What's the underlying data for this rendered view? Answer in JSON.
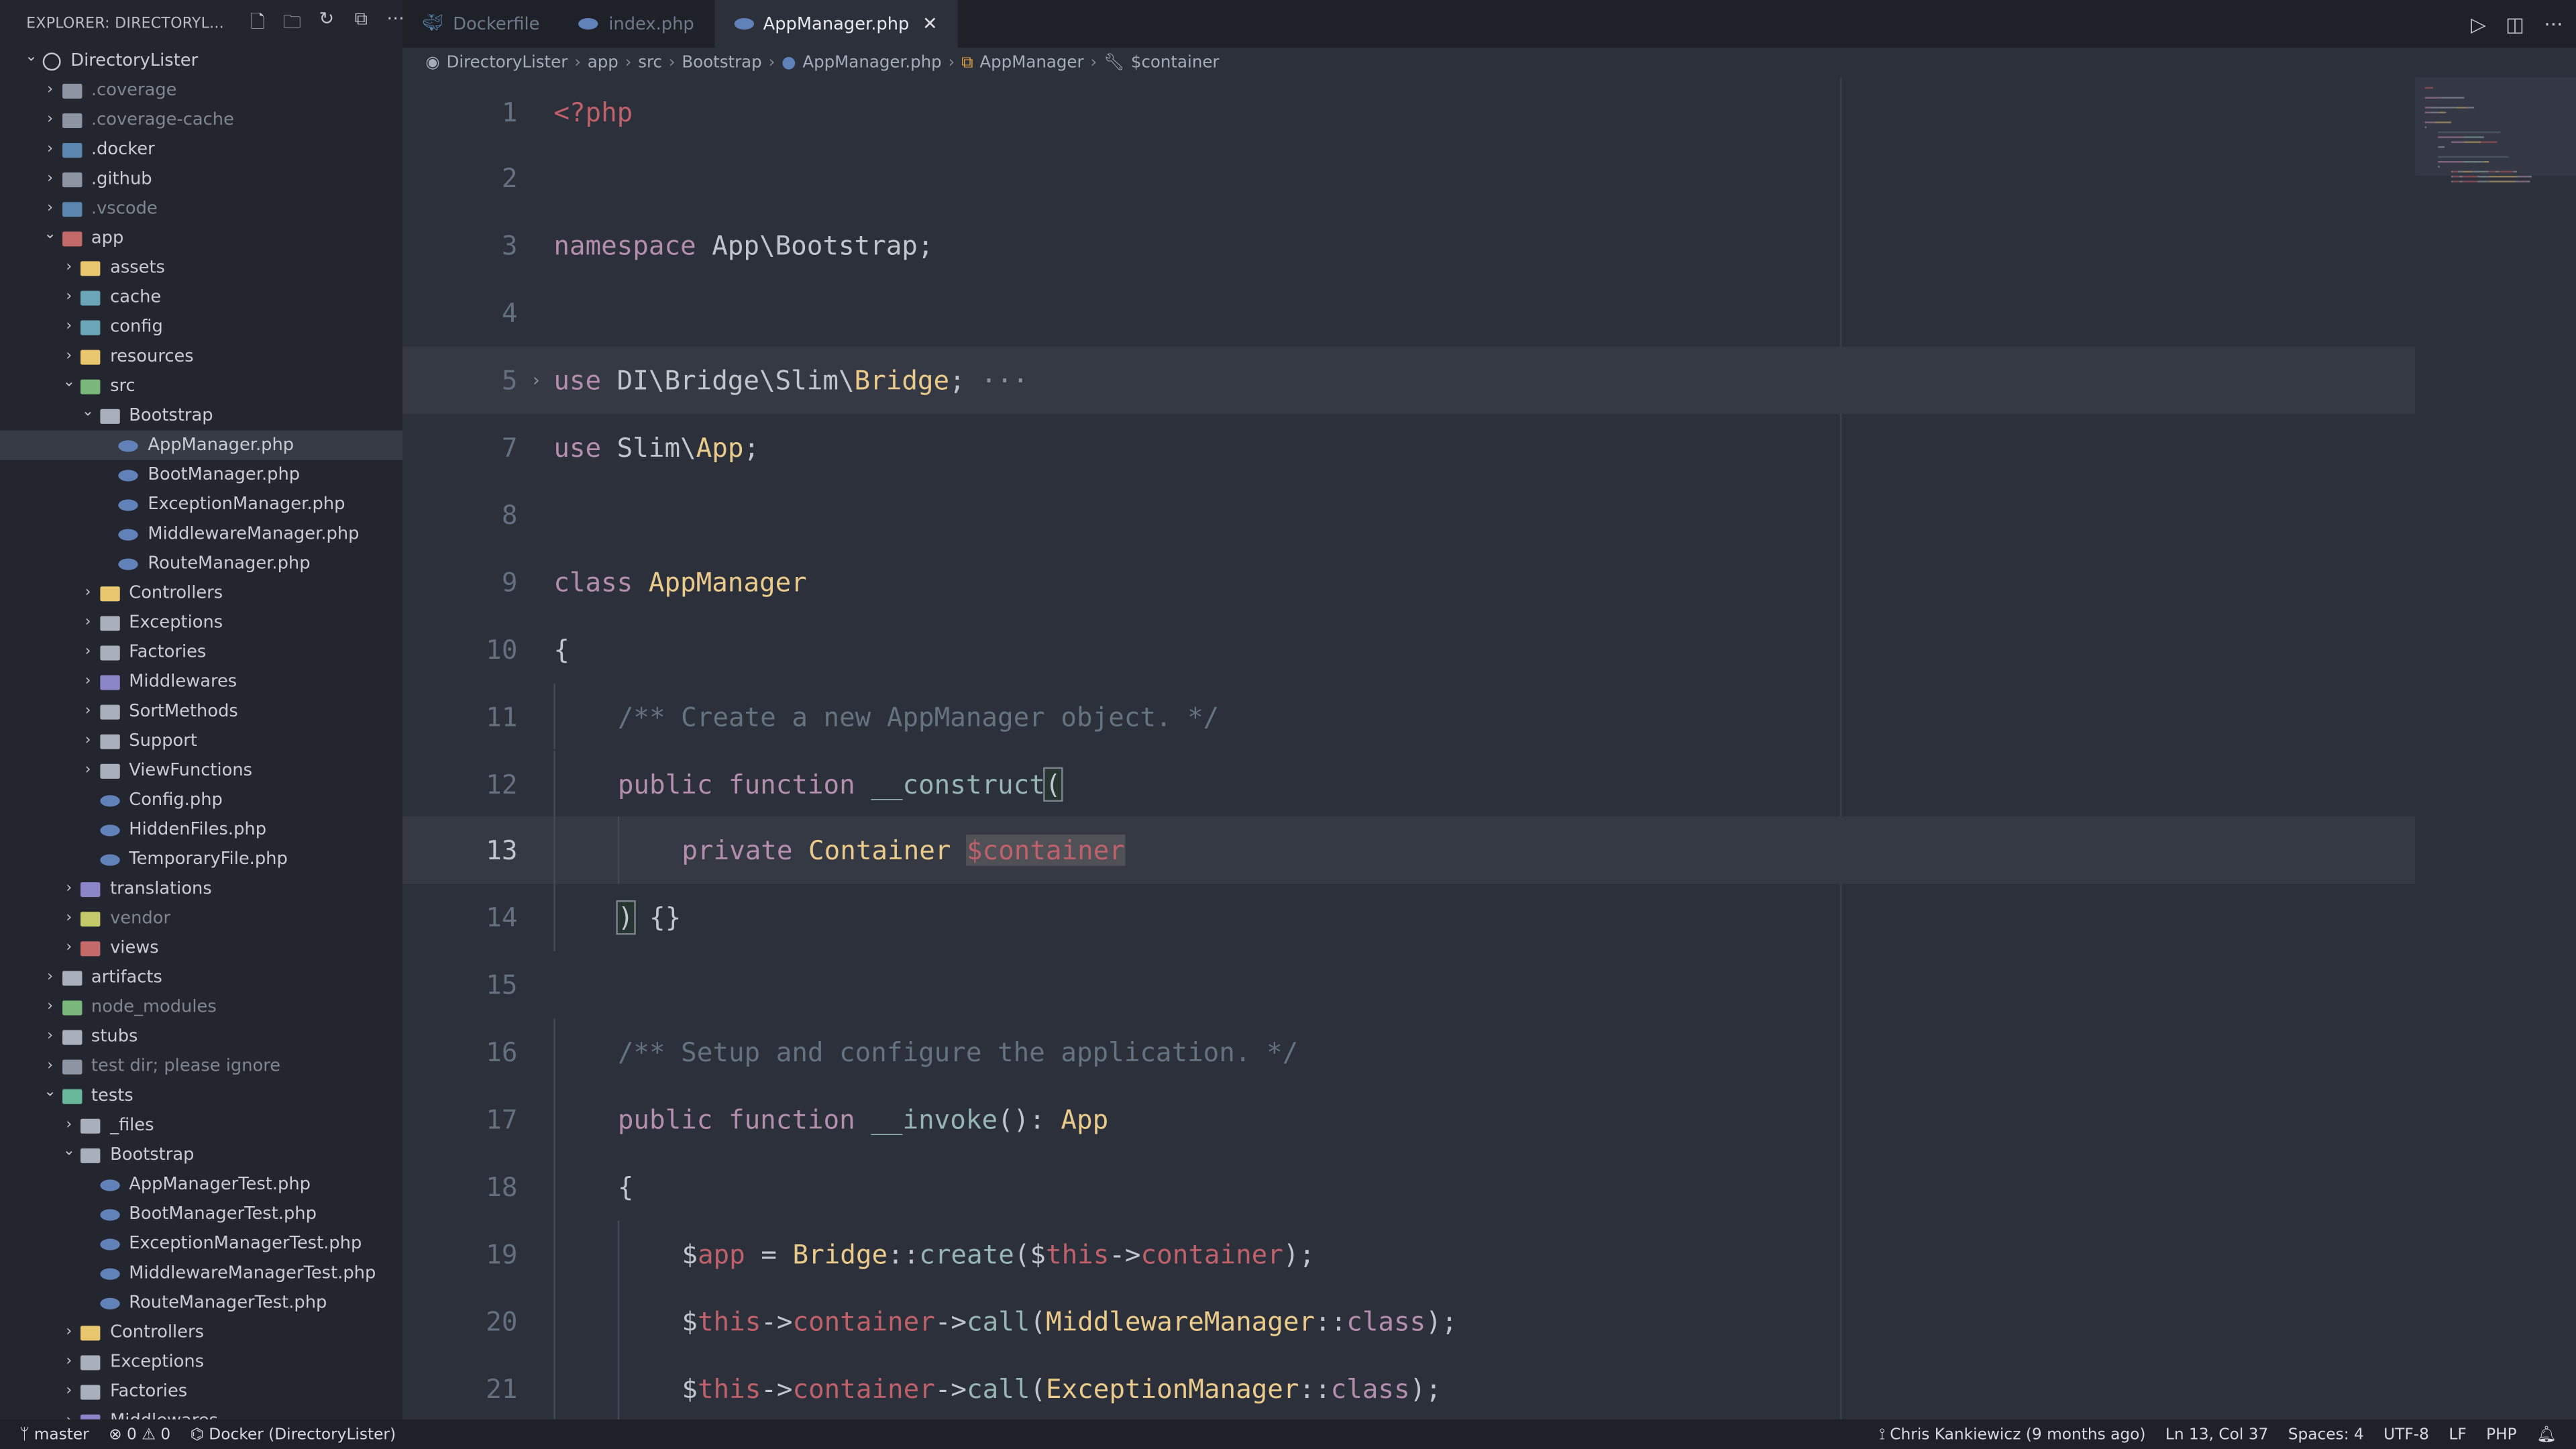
{
  "explorer": {
    "title": "EXPLORER: DIRECTORYL...",
    "actions": [
      {
        "name": "new-file-icon",
        "glyph": "🗋"
      },
      {
        "name": "new-folder-icon",
        "glyph": "🗀"
      },
      {
        "name": "refresh-icon",
        "glyph": "↻"
      },
      {
        "name": "collapse-all-icon",
        "glyph": "⧉"
      },
      {
        "name": "more-icon",
        "glyph": "···"
      }
    ]
  },
  "tree": [
    {
      "d": 0,
      "t": "root",
      "open": true,
      "label": "DirectoryLister"
    },
    {
      "d": 1,
      "t": "folder",
      "label": ".coverage",
      "color": "#8e95a2",
      "dim": true
    },
    {
      "d": 1,
      "t": "folder",
      "label": ".coverage-cache",
      "color": "#8e95a2",
      "dim": true
    },
    {
      "d": 1,
      "t": "folder",
      "label": ".docker",
      "color": "#5b86b0"
    },
    {
      "d": 1,
      "t": "folder",
      "label": ".github",
      "color": "#8e95a2"
    },
    {
      "d": 1,
      "t": "folder",
      "label": ".vscode",
      "color": "#5b86b0",
      "dim": true
    },
    {
      "d": 1,
      "t": "folder",
      "open": true,
      "label": "app",
      "color": "#c46a6a"
    },
    {
      "d": 2,
      "t": "folder",
      "label": "assets",
      "color": "#e8c76f"
    },
    {
      "d": 2,
      "t": "folder",
      "label": "cache",
      "color": "#6aa6b8"
    },
    {
      "d": 2,
      "t": "folder",
      "label": "config",
      "color": "#6aa6b8"
    },
    {
      "d": 2,
      "t": "folder",
      "label": "resources",
      "color": "#e8c76f"
    },
    {
      "d": 2,
      "t": "folder",
      "open": true,
      "label": "src",
      "color": "#7ab77a"
    },
    {
      "d": 3,
      "t": "folder",
      "open": true,
      "label": "Bootstrap",
      "color": "#a9b0bb"
    },
    {
      "d": 4,
      "t": "file",
      "label": "AppManager.php",
      "sel": true
    },
    {
      "d": 4,
      "t": "file",
      "label": "BootManager.php"
    },
    {
      "d": 4,
      "t": "file",
      "label": "ExceptionManager.php"
    },
    {
      "d": 4,
      "t": "file",
      "label": "MiddlewareManager.php"
    },
    {
      "d": 4,
      "t": "file",
      "label": "RouteManager.php"
    },
    {
      "d": 3,
      "t": "folder",
      "label": "Controllers",
      "color": "#e8c76f"
    },
    {
      "d": 3,
      "t": "folder",
      "label": "Exceptions",
      "color": "#a9b0bb"
    },
    {
      "d": 3,
      "t": "folder",
      "label": "Factories",
      "color": "#a9b0bb"
    },
    {
      "d": 3,
      "t": "folder",
      "label": "Middlewares",
      "color": "#8b86c8"
    },
    {
      "d": 3,
      "t": "folder",
      "label": "SortMethods",
      "color": "#a9b0bb"
    },
    {
      "d": 3,
      "t": "folder",
      "label": "Support",
      "color": "#a9b0bb"
    },
    {
      "d": 3,
      "t": "folder",
      "label": "ViewFunctions",
      "color": "#a9b0bb"
    },
    {
      "d": 3,
      "t": "file",
      "label": "Config.php"
    },
    {
      "d": 3,
      "t": "file",
      "label": "HiddenFiles.php"
    },
    {
      "d": 3,
      "t": "file",
      "label": "TemporaryFile.php"
    },
    {
      "d": 2,
      "t": "folder",
      "label": "translations",
      "color": "#8b86c8"
    },
    {
      "d": 2,
      "t": "folder",
      "label": "vendor",
      "color": "#c4c96a",
      "dim": true
    },
    {
      "d": 2,
      "t": "folder",
      "label": "views",
      "color": "#c46a6a"
    },
    {
      "d": 1,
      "t": "folder",
      "label": "artifacts",
      "color": "#a9b0bb"
    },
    {
      "d": 1,
      "t": "folder",
      "label": "node_modules",
      "color": "#7ab77a",
      "dim": true
    },
    {
      "d": 1,
      "t": "folder",
      "label": "stubs",
      "color": "#a9b0bb"
    },
    {
      "d": 1,
      "t": "folder",
      "label": "test dir; please ignore",
      "color": "#8e95a2",
      "dim": true
    },
    {
      "d": 1,
      "t": "folder",
      "open": true,
      "label": "tests",
      "color": "#6ab89a"
    },
    {
      "d": 2,
      "t": "folder",
      "label": "_files",
      "color": "#a9b0bb"
    },
    {
      "d": 2,
      "t": "folder",
      "open": true,
      "label": "Bootstrap",
      "color": "#a9b0bb"
    },
    {
      "d": 3,
      "t": "file",
      "label": "AppManagerTest.php"
    },
    {
      "d": 3,
      "t": "file",
      "label": "BootManagerTest.php"
    },
    {
      "d": 3,
      "t": "file",
      "label": "ExceptionManagerTest.php"
    },
    {
      "d": 3,
      "t": "file",
      "label": "MiddlewareManagerTest.php"
    },
    {
      "d": 3,
      "t": "file",
      "label": "RouteManagerTest.php"
    },
    {
      "d": 2,
      "t": "folder",
      "label": "Controllers",
      "color": "#e8c76f"
    },
    {
      "d": 2,
      "t": "folder",
      "label": "Exceptions",
      "color": "#a9b0bb"
    },
    {
      "d": 2,
      "t": "folder",
      "label": "Factories",
      "color": "#a9b0bb"
    },
    {
      "d": 2,
      "t": "folder",
      "label": "Middlewares",
      "color": "#8b86c8"
    }
  ],
  "tabs": [
    {
      "label": "Dockerfile",
      "icon": "docker-icon"
    },
    {
      "label": "index.php",
      "icon": "php-icon"
    },
    {
      "label": "AppManager.php",
      "icon": "php-icon",
      "active": true
    }
  ],
  "tab_actions": [
    {
      "name": "run-debug-icon",
      "glyph": "▷"
    },
    {
      "name": "split-editor-icon",
      "glyph": "◫"
    },
    {
      "name": "more-icon",
      "glyph": "···"
    }
  ],
  "breadcrumbs": [
    "DirectoryLister",
    "app",
    "src",
    "Bootstrap",
    "AppManager.php",
    "AppManager",
    "$container"
  ],
  "code": [
    {
      "n": "1",
      "tokens": [
        [
          "<?php",
          "v"
        ]
      ]
    },
    {
      "n": "2",
      "tokens": []
    },
    {
      "n": "3",
      "tokens": [
        [
          "namespace ",
          "k"
        ],
        [
          "App\\Bootstrap;",
          "p"
        ]
      ]
    },
    {
      "n": "4",
      "tokens": []
    },
    {
      "n": "5",
      "folded": true,
      "hl": true,
      "tokens": [
        [
          "use ",
          "k"
        ],
        [
          "DI\\Bridge\\Slim\\",
          "p"
        ],
        [
          "Bridge",
          "c"
        ],
        [
          ";",
          "p"
        ],
        [
          " ···",
          "dots"
        ]
      ]
    },
    {
      "n": "7",
      "tokens": [
        [
          "use ",
          "k"
        ],
        [
          "Slim\\",
          "p"
        ],
        [
          "App",
          "c"
        ],
        [
          ";",
          "p"
        ]
      ]
    },
    {
      "n": "8",
      "tokens": []
    },
    {
      "n": "9",
      "tokens": [
        [
          "class ",
          "k"
        ],
        [
          "AppManager",
          "c"
        ]
      ]
    },
    {
      "n": "10",
      "tokens": [
        [
          "{",
          "p"
        ]
      ]
    },
    {
      "n": "11",
      "indent": 1,
      "tokens": [
        [
          "/** Create a new AppManager object. */",
          "cm"
        ]
      ]
    },
    {
      "n": "12",
      "indent": 1,
      "tokens": [
        [
          "public ",
          "k"
        ],
        [
          "function ",
          "k"
        ],
        [
          "__construct",
          "f"
        ],
        [
          "(",
          "brk"
        ]
      ]
    },
    {
      "n": "13",
      "indent": 2,
      "cur": true,
      "hl": true,
      "tokens": [
        [
          "private ",
          "k"
        ],
        [
          "Container ",
          "c"
        ],
        [
          "$container",
          "vsel"
        ]
      ]
    },
    {
      "n": "14",
      "indent": 1,
      "tokens": [
        [
          ")",
          "brk"
        ],
        [
          " {}",
          "p"
        ]
      ]
    },
    {
      "n": "15",
      "tokens": []
    },
    {
      "n": "16",
      "indent": 1,
      "tokens": [
        [
          "/** Setup and configure the application. */",
          "cm"
        ]
      ]
    },
    {
      "n": "17",
      "indent": 1,
      "tokens": [
        [
          "public ",
          "k"
        ],
        [
          "function ",
          "k"
        ],
        [
          "__invoke",
          "f"
        ],
        [
          "(): ",
          "p"
        ],
        [
          "App",
          "c"
        ]
      ]
    },
    {
      "n": "18",
      "indent": 1,
      "tokens": [
        [
          "{",
          "p"
        ]
      ]
    },
    {
      "n": "19",
      "indent": 2,
      "tokens": [
        [
          "$",
          "p"
        ],
        [
          "app",
          "v"
        ],
        [
          " = ",
          "p"
        ],
        [
          "Bridge",
          "c"
        ],
        [
          "::",
          "p"
        ],
        [
          "create",
          "f"
        ],
        [
          "($",
          "p"
        ],
        [
          "this",
          "v"
        ],
        [
          "->",
          "p"
        ],
        [
          "container",
          "v"
        ],
        [
          ");",
          "p"
        ]
      ]
    },
    {
      "n": "20",
      "indent": 2,
      "tokens": [
        [
          "$",
          "p"
        ],
        [
          "this",
          "v"
        ],
        [
          "->",
          "p"
        ],
        [
          "container",
          "v"
        ],
        [
          "->",
          "p"
        ],
        [
          "call",
          "f"
        ],
        [
          "(",
          "p"
        ],
        [
          "MiddlewareManager",
          "c"
        ],
        [
          "::",
          "p"
        ],
        [
          "class",
          "k"
        ],
        [
          ");",
          "p"
        ]
      ]
    },
    {
      "n": "21",
      "indent": 2,
      "tokens": [
        [
          "$",
          "p"
        ],
        [
          "this",
          "v"
        ],
        [
          "->",
          "p"
        ],
        [
          "container",
          "v"
        ],
        [
          "->",
          "p"
        ],
        [
          "call",
          "f"
        ],
        [
          "(",
          "p"
        ],
        [
          "ExceptionManager",
          "c"
        ],
        [
          "::",
          "p"
        ],
        [
          "class",
          "k"
        ],
        [
          ");",
          "p"
        ]
      ]
    }
  ],
  "status": {
    "branch": "master",
    "errors": "0",
    "warnings": "0",
    "remote": "Docker (DirectoryLister)",
    "blame": "Chris Kankiewicz (9 months ago)",
    "position": "Ln 13, Col 37",
    "indent": "Spaces: 4",
    "encoding": "UTF-8",
    "eol": "LF",
    "language": "PHP"
  },
  "colors": {
    "keyword": "#b48ead",
    "class": "#ebcb8b",
    "function": "#96b5b4",
    "variable": "#bf616a",
    "comment": "#65737e",
    "editor_bg": "#2b303b"
  }
}
